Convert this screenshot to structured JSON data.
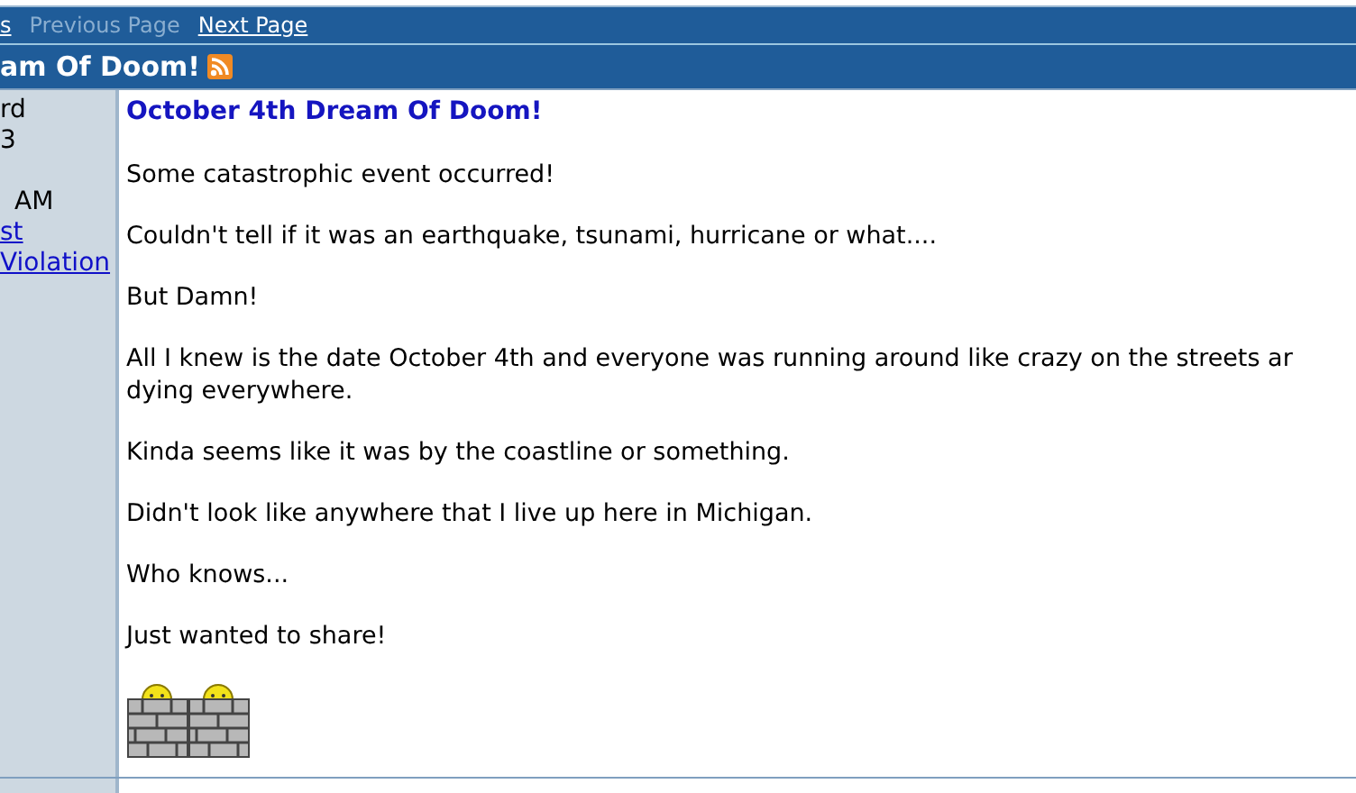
{
  "nav": [
    {
      "label": "s",
      "disabled": false
    },
    {
      "label": "Previous Page",
      "disabled": true
    },
    {
      "label": "Next Page",
      "disabled": false
    }
  ],
  "thread_title": "am Of Doom!",
  "post": {
    "author_lines": [
      {
        "text": "rd",
        "kind": "text"
      },
      {
        "text": "3",
        "kind": "text"
      },
      {
        "text": "AM",
        "kind": "gap-text"
      },
      {
        "text": "st",
        "kind": "link"
      },
      {
        "text": "Violation",
        "kind": "link"
      }
    ],
    "subject": "October 4th Dream Of Doom!",
    "paragraphs": [
      [
        "Some catastrophic event occurred!"
      ],
      [
        "Couldn't tell if it was an earthquake, tsunami, hurricane or what...."
      ],
      [
        "But Damn!"
      ],
      [
        "All I knew is the date October 4th and everyone was running around like crazy on the streets ar",
        "dying everywhere."
      ],
      [
        "Kinda seems like it was by the coastline or something."
      ],
      [
        "Didn't look like anywhere that I live up here in Michigan."
      ],
      [
        "Who knows..."
      ],
      [
        "Just wanted to share!"
      ]
    ]
  }
}
